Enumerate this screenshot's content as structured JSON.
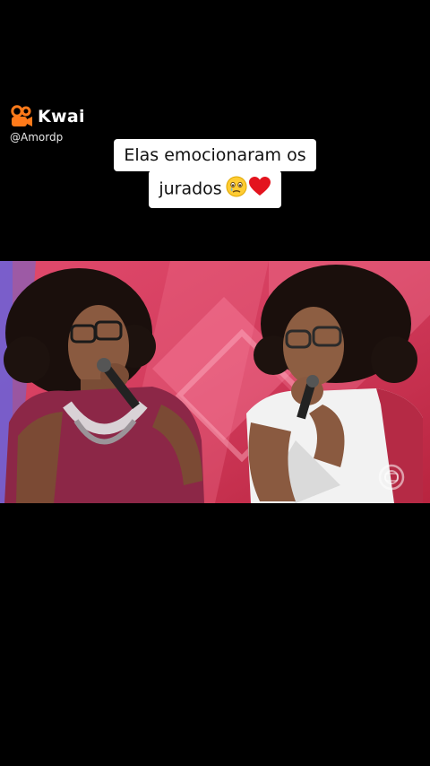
{
  "watermark": {
    "app_name": "Kwai",
    "username": "@Amordp",
    "logo_icon": "kwai-camera-icon",
    "accent": "#ff7a1a"
  },
  "caption": {
    "line1": "Elas emocionaram os",
    "line2": "jurados",
    "emojis": [
      "crying-face-icon",
      "red-heart-icon"
    ]
  },
  "video": {
    "description_icon": "video-frame",
    "channel_logo_icon": "tv-channel-logo-icon"
  }
}
